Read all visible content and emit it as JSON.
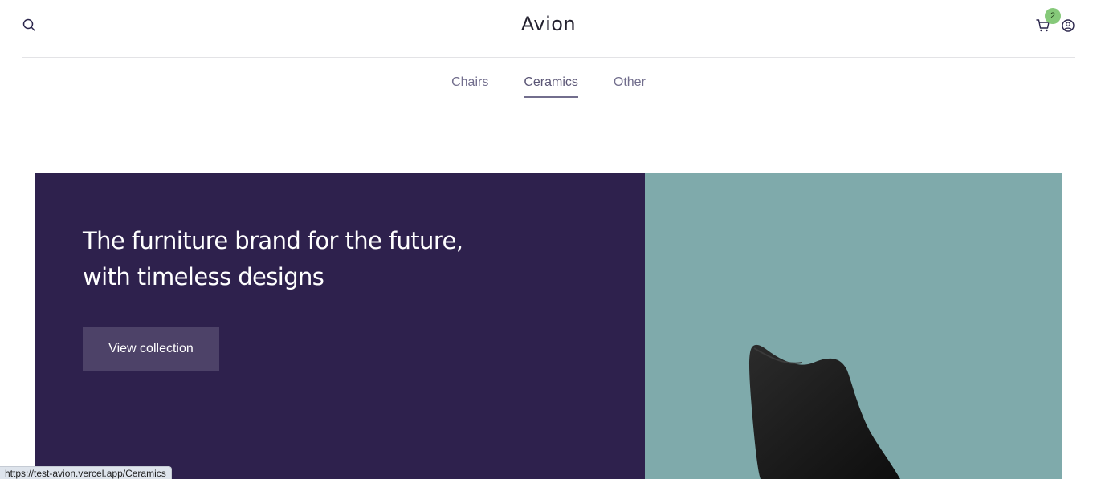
{
  "header": {
    "brand": "Avion",
    "cart_count": "2"
  },
  "nav": {
    "items": [
      "Chairs",
      "Ceramics",
      "Other"
    ],
    "active": "Ceramics"
  },
  "hero": {
    "title": "The furniture brand for the future, with timeless designs",
    "button_label": "View collection"
  },
  "status_bar": {
    "url": "https://test-avion.vercel.app/Ceramics"
  },
  "icons": {
    "search": "search-icon",
    "cart": "cart-icon",
    "user": "user-icon"
  },
  "colors": {
    "hero_dark": "#2e214d",
    "hero_button": "#4d4268",
    "hero_teal": "#7faaab",
    "badge": "#86c97a",
    "nav_text": "#726e8d"
  }
}
